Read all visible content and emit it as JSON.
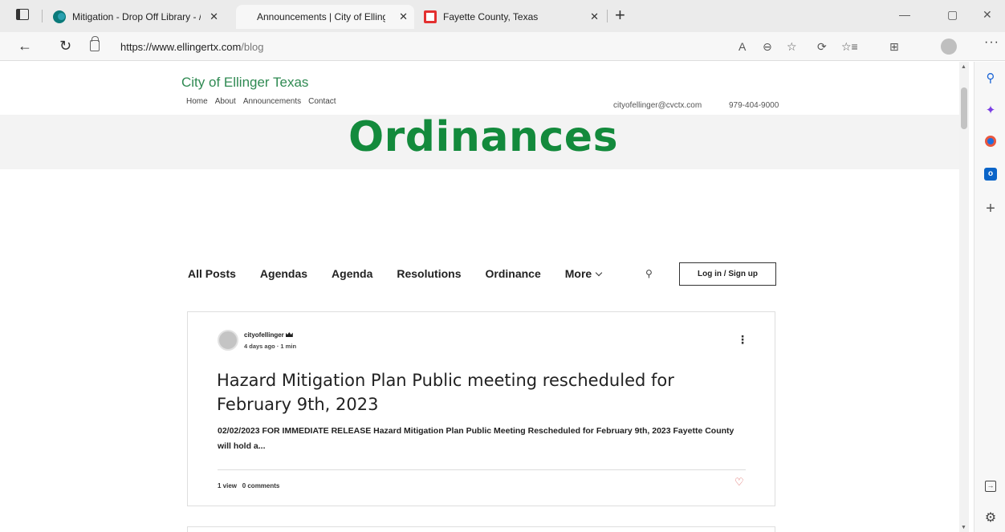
{
  "browser": {
    "tabs": [
      {
        "title": "Mitigation - Drop Off Library - /",
        "active": false
      },
      {
        "title": "Announcements | City of Ellinge",
        "active": true
      },
      {
        "title": "Fayette County, Texas",
        "active": false
      }
    ],
    "close_glyph": "✕",
    "new_tab_glyph": "+",
    "url_host": "https://www.ellingertx.com",
    "url_path": "/blog",
    "window": {
      "minimize": "—",
      "maximize": "▢",
      "close": "✕"
    },
    "toolbar_icons": {
      "read_aloud": "A",
      "zoom": "⊖",
      "favorite": "☆",
      "extensions": "⟳",
      "favorites_list": "☆≡",
      "collections": "⊞",
      "more": "···"
    }
  },
  "sidebar": {
    "search": "⚲",
    "copilot": "✦",
    "outlook": "o",
    "add": "+",
    "bottom_panel": "→",
    "settings": "⚙"
  },
  "site": {
    "title": "City of Ellinger Texas",
    "nav": [
      "Home",
      "About",
      "Announcements",
      "Contact"
    ],
    "email": "cityofellinger@cvctx.com",
    "phone": "979-404-9000",
    "hero_title": "Ordinances"
  },
  "blog": {
    "categories": [
      "All Posts",
      "Agendas",
      "Agenda",
      "Resolutions",
      "Ordinance"
    ],
    "more_label": "More",
    "search_glyph": "⚲",
    "login_label": "Log in / Sign up"
  },
  "post": {
    "author": "cityofellinger",
    "meta": "4 days ago · 1 min",
    "title": "Hazard Mitigation Plan Public meeting rescheduled for February 9th, 2023",
    "excerpt": "02/02/2023 FOR IMMEDIATE RELEASE Hazard Mitigation Plan Public Meeting Rescheduled for February 9th, 2023 Fayette County will hold a...",
    "views": "1 view",
    "comments": "0 comments",
    "kebab": "⋮",
    "heart": "♡"
  }
}
